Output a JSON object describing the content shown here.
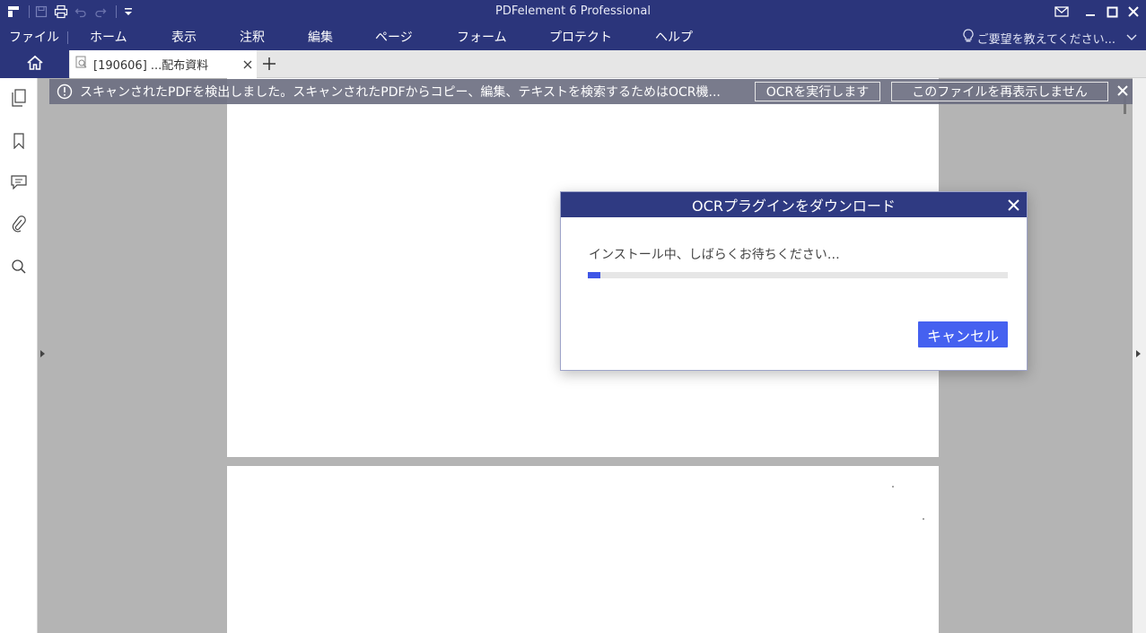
{
  "window": {
    "title": "PDFelement 6 Professional"
  },
  "menu": {
    "items": [
      "ファイル",
      "ホーム",
      "表示",
      "注釈",
      "編集",
      "ページ",
      "フォーム",
      "プロテクト",
      "ヘルプ"
    ],
    "feedback": "ご要望を教えてください..."
  },
  "tabs": {
    "doc_label": "[190606] ...配布資料"
  },
  "notification": {
    "message": "スキャンされたPDFを検出しました。スキャンされたPDFからコピー、編集、テキストを検索するためはOCR機...",
    "run_ocr_label": "OCRを実行します",
    "dont_show_label": "このファイルを再表示しません"
  },
  "dialog": {
    "title": "OCRプラグインをダウンロード",
    "message": "インストール中、しばらくお待ちください…",
    "progress": 0.03,
    "cancel_label": "キャンセル"
  },
  "colors": {
    "titlebar": "#2b357b",
    "dialog_header": "#2f3a82",
    "accent": "#4561f0",
    "progress": "#3f56e6"
  }
}
